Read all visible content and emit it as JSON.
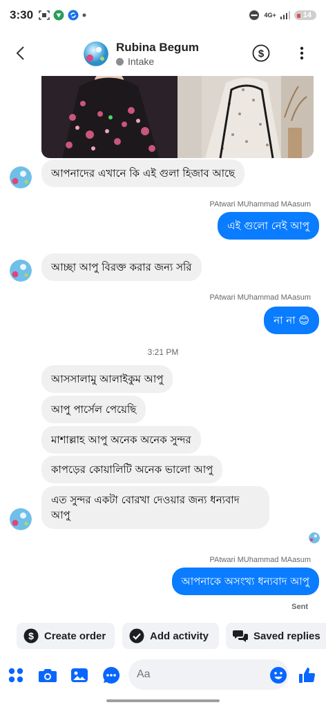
{
  "status_bar": {
    "time": "3:30",
    "network": "4G+",
    "battery": "14"
  },
  "header": {
    "contact_name": "Rubina Begum",
    "status": "Intake"
  },
  "messages": {
    "in_1": "আপনাদের এখানে কি এই গুলা হিজাব আছে",
    "sender_1": "PAtwari MUhammad MAasum",
    "out_1": "এই গুলো নেই আপু",
    "in_2": "আচ্ছা আপু বিরক্ত করার জন্য সরি",
    "sender_2": "PAtwari MUhammad MAasum",
    "out_2": "না না 😊",
    "timestamp": "3:21 PM",
    "in_3": "আসসালামু আলাইকুম আপু",
    "in_4": "আপু পার্সেল পেয়েছি",
    "in_5": "মাশাল্লাহ আপু অনেক অনেক সুন্দর",
    "in_6": "কাপড়ের কোয়ালিটি অনেক ভালো আপু",
    "in_7_line1": "এত সুন্দর একটা বোরখা দেওয়ার জন্য ধন্যবাদ",
    "in_7_line2": "আপু",
    "sender_3": "PAtwari MUhammad MAasum",
    "out_3": "আপনাকে অসংখ্য ধন্যবাদ আপু",
    "sent_status": "Sent"
  },
  "quick_actions": {
    "create_order": "Create order",
    "add_activity": "Add activity",
    "saved_replies": "Saved replies"
  },
  "composer": {
    "placeholder": "Aa"
  },
  "colors": {
    "accent": "#0a7cff",
    "incoming_bubble": "#f0f0f0",
    "messenger_blue": "#0866ff"
  },
  "icons": [
    "back-arrow-icon",
    "dollar-icon",
    "more-vert-icon",
    "apps-icon",
    "camera-icon",
    "gallery-icon",
    "voice-icon",
    "emoji-icon",
    "like-icon"
  ]
}
